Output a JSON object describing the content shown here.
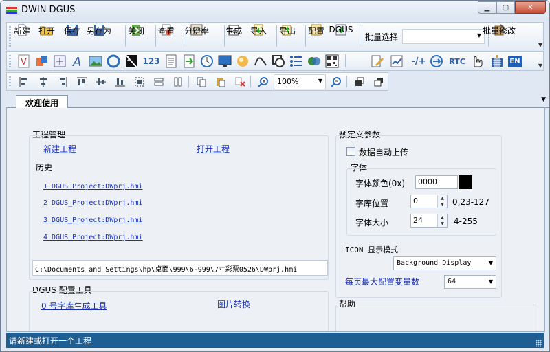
{
  "window": {
    "title": "DWIN DGUS"
  },
  "toolbar1": {
    "buttons": [
      {
        "label": "新建"
      },
      {
        "label": "打开"
      },
      {
        "label": "保存"
      },
      {
        "label": "另存为"
      },
      {
        "label": "关闭"
      },
      {
        "label": "查看"
      },
      {
        "label": "分辨率"
      },
      {
        "label": "生成"
      },
      {
        "label": "导入"
      },
      {
        "label": "导出"
      },
      {
        "label": "配置"
      },
      {
        "label": "DGUS"
      }
    ],
    "batch_select_label": "批量选择",
    "batch_select_value": "",
    "batch_modify_label": "批量修改"
  },
  "toolbar2": {
    "numeric_icon_text": "123",
    "rtc_text": "RTC",
    "en_text": "EN",
    "sign_text": "-/+"
  },
  "toolbar3": {
    "zoom_value": "100%"
  },
  "tabs": [
    {
      "label": "欢迎使用"
    }
  ],
  "project": {
    "title": "工程管理",
    "new_link": "新建工程",
    "open_link": "打开工程",
    "history_title": "历史",
    "history": [
      "1 DGUS_Project:DWprj.hmi",
      "2 DGUS_Project:DWprj.hmi",
      "3 DGUS_Project:DWprj.hmi",
      "4 DGUS_Project:DWprj.hmi"
    ],
    "path": "C:\\Documents and Settings\\hp\\桌面\\999\\6-999\\7寸彩票0526\\DWprj.hmi"
  },
  "tools": {
    "title": "DGUS 配置工具",
    "item1": "0 号字库生成工具",
    "item2": "图片转换"
  },
  "params": {
    "title": "预定义参数",
    "auto_upload_label": "数据自动上传",
    "font_group_title": "字体",
    "font_color_label": "字体颜色(0x)",
    "font_color_value": "0000",
    "font_pos_label": "字库位置",
    "font_pos_value": "0",
    "font_pos_range": "0,23-127",
    "font_size_label": "字体大小",
    "font_size_value": "24",
    "font_size_range": "4-255",
    "icon_mode_label": "ICON 显示模式",
    "icon_mode_value": "Background Display",
    "max_vars_label": "每页最大配置变量数",
    "max_vars_value": "64"
  },
  "help": {
    "title": "帮助"
  },
  "status": {
    "text": "请新建或打开一个工程"
  }
}
